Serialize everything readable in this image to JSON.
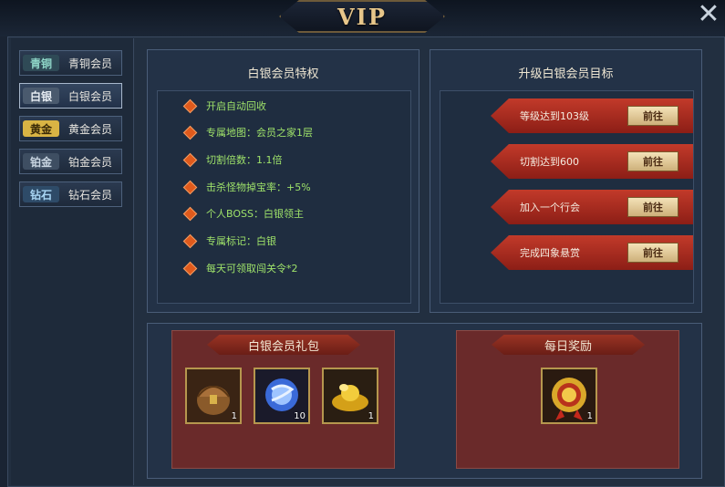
{
  "title": "VIP",
  "close_icon": "close-icon",
  "tabs": [
    {
      "badge": "青铜",
      "label": "青铜会员",
      "badge_color": "#8fd6c8"
    },
    {
      "badge": "白银",
      "label": "白银会员",
      "badge_color": "#e8eef4"
    },
    {
      "badge": "黄金",
      "label": "黄金会员",
      "badge_color": "#e9c553"
    },
    {
      "badge": "铂金",
      "label": "铂金会员",
      "badge_color": "#c9d6e2"
    },
    {
      "badge": "钻石",
      "label": "钻石会员",
      "badge_color": "#a9d6f4"
    }
  ],
  "privileges": {
    "title": "白银会员特权",
    "items": [
      "开启自动回收",
      "专属地图：会员之家1层",
      "切割倍数：1.1倍",
      "击杀怪物掉宝率：+5%",
      "个人BOSS：白银领主",
      "专属标记：白银",
      "每天可领取闯关令*2"
    ]
  },
  "goals": {
    "title": "升级白银会员目标",
    "items": [
      {
        "text": "等级达到103级",
        "button": "前往"
      },
      {
        "text": "切割达到600",
        "button": "前往"
      },
      {
        "text": "加入一个行会",
        "button": "前往"
      },
      {
        "text": "完成四象悬赏",
        "button": "前往"
      }
    ]
  },
  "gift_pack": {
    "title": "白银会员礼包",
    "items": [
      {
        "icon": "treasure-chest-icon",
        "count": "1"
      },
      {
        "icon": "blue-orb-icon",
        "count": "10"
      },
      {
        "icon": "gold-ingot-icon",
        "count": "1"
      }
    ]
  },
  "daily_reward": {
    "title": "每日奖励",
    "items": [
      {
        "icon": "gold-medal-icon",
        "count": "1"
      }
    ]
  },
  "colors": {
    "accent_red": "#b8322a",
    "gold": "#e7c68a",
    "green_text": "#9fe36a"
  }
}
